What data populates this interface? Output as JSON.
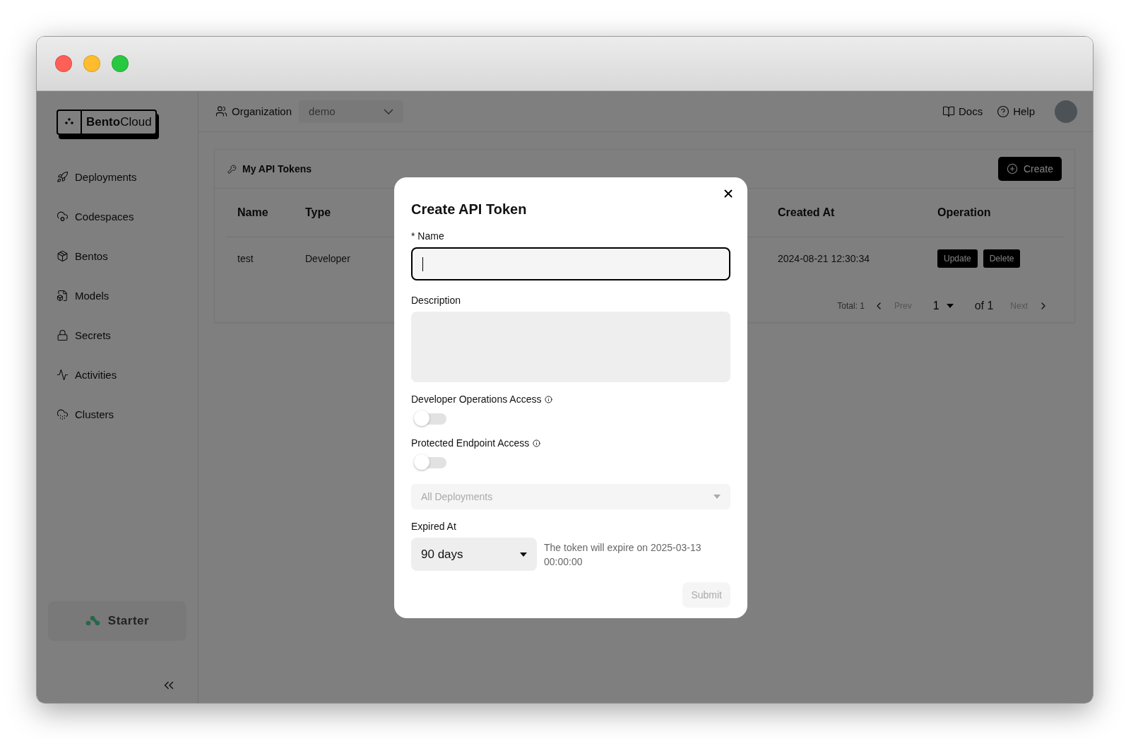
{
  "sidebar": {
    "logo": {
      "bold": "Bento",
      "regular": "Cloud"
    },
    "items": [
      {
        "label": "Deployments"
      },
      {
        "label": "Codespaces"
      },
      {
        "label": "Bentos"
      },
      {
        "label": "Models"
      },
      {
        "label": "Secrets"
      },
      {
        "label": "Activities"
      },
      {
        "label": "Clusters"
      }
    ],
    "plan": "Starter"
  },
  "topbar": {
    "org_label": "Organization",
    "org_value": "demo",
    "links": [
      "Docs",
      "Help"
    ]
  },
  "card": {
    "title": "My API Tokens",
    "create_button": "Create"
  },
  "table": {
    "columns": [
      "Name",
      "Type",
      "Created At",
      "Operation"
    ],
    "rows": [
      {
        "name": "test",
        "type": "Developer",
        "created_at": "2024-08-21 12:30:34",
        "actions": [
          "Update",
          "Delete"
        ]
      }
    ]
  },
  "pagination": {
    "total": "Total: 1",
    "prev": "Prev",
    "prev_disabled": true,
    "page": "1",
    "of": "of 1",
    "next": "Next",
    "next_disabled": true
  },
  "modal": {
    "title": "Create API Token",
    "name": {
      "label": "* Name",
      "focused": true
    },
    "description": {
      "label": "Description"
    },
    "toggles": [
      {
        "label": "Developer Operations Access",
        "on": false
      },
      {
        "label": "Protected Endpoint Access",
        "on": false
      }
    ],
    "deployments": {
      "placeholder": "All Deployments",
      "disabled": true
    },
    "expired": {
      "label": "Expired At",
      "value": "90 days",
      "note": "The token will expire on 2025-03-13 00:00:00"
    },
    "submit": {
      "label": "Submit",
      "disabled": true
    }
  }
}
